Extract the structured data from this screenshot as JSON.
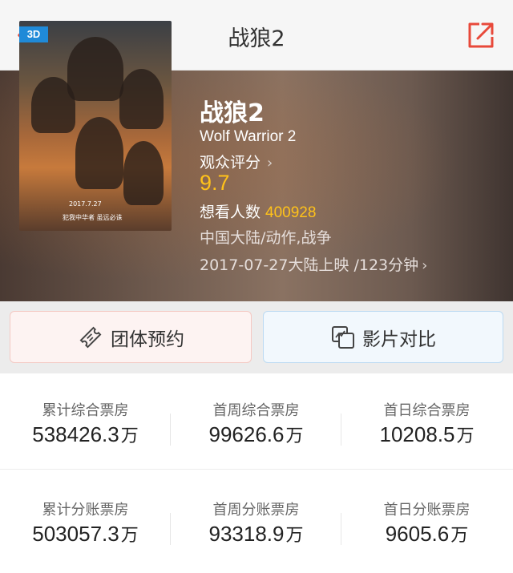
{
  "header": {
    "title": "战狼2",
    "back_icon": "chevron-left-icon",
    "share_icon": "share-external-icon",
    "accent_color": "#e8493a"
  },
  "movie": {
    "badge": "3D",
    "poster_caption_1": "2017.7.27",
    "poster_caption_2": "犯我中华者 虽远必诛",
    "title": "战狼2",
    "english_title": "Wolf Warrior 2",
    "rating_label": "观众评分",
    "rating_chevron": "›",
    "rating": "9.7",
    "want_label": "想看人数",
    "want_count": "400928",
    "genre": "中国大陆/动作,战争",
    "release": "2017-07-27大陆上映 /123分钟",
    "release_chevron": "›",
    "highlight_color": "#ffc21a"
  },
  "actions": {
    "group_booking": "团体预约",
    "compare": "影片对比"
  },
  "stats": {
    "row1": [
      {
        "label": "累计综合票房",
        "value": "538426.3",
        "unit": "万"
      },
      {
        "label": "首周综合票房",
        "value": "99626.6",
        "unit": "万"
      },
      {
        "label": "首日综合票房",
        "value": "10208.5",
        "unit": "万"
      }
    ],
    "row2": [
      {
        "label": "累计分账票房",
        "value": "503057.3",
        "unit": "万"
      },
      {
        "label": "首周分账票房",
        "value": "93318.9",
        "unit": "万"
      },
      {
        "label": "首日分账票房",
        "value": "9605.6",
        "unit": "万"
      }
    ]
  }
}
